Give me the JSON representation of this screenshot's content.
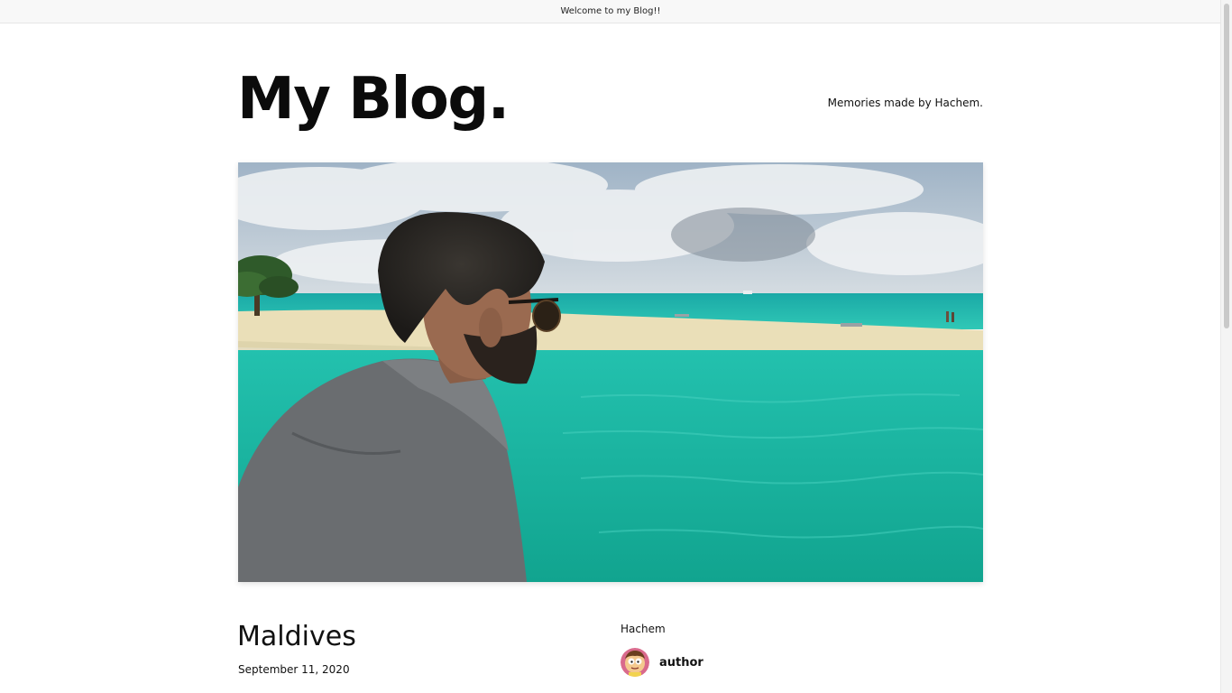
{
  "announcement_bar": {
    "text": "Welcome to my Blog!!"
  },
  "header": {
    "site_title": "My Blog.",
    "tagline": "Memories made by Hachem."
  },
  "hero": {
    "image_name": "beach-photo"
  },
  "post": {
    "title": "Maldives",
    "date": "September 11, 2020"
  },
  "author": {
    "name": "Hachem",
    "role": "author",
    "avatar_icon": "cartoon-avatar-icon"
  },
  "colors": {
    "sea": "#1fb8a4",
    "sand": "#eadfb8",
    "sky": "#c9d3dc",
    "shirt": "#6a6d70"
  }
}
